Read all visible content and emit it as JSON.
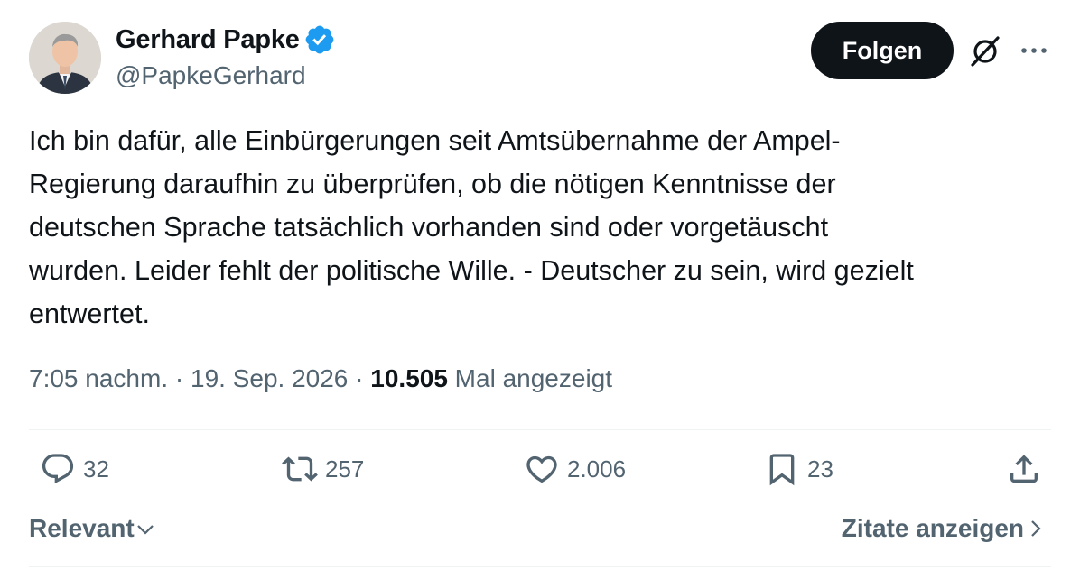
{
  "author": {
    "name": "Gerhard Papke",
    "handle": "@PapkeGerhard",
    "verified": true
  },
  "header": {
    "follow_label": "Folgen",
    "icons": [
      "grok-icon",
      "more-icon"
    ]
  },
  "tweet": {
    "text": "Ich bin dafür, alle Einbürgerungen seit Amtsübernahme der Ampel-\nRegierung daraufhin zu überprüfen, ob die nötigen Kenntnisse der\ndeutschen Sprache tatsächlich vorhanden sind oder vorgetäuscht\nwurden. Leider fehlt der politische Wille. - Deutscher zu sein, wird gezielt\nentwertet.",
    "time": "7:05 nachm.",
    "sep1": " · ",
    "date": "19. Sep. 2026",
    "sep2": " · ",
    "views": "10.505",
    "views_label": " Mal angezeigt"
  },
  "actions": {
    "replies": "32",
    "reposts": "257",
    "likes": "2.006",
    "bookmarks": "23"
  },
  "footer": {
    "sort_label": "Relevant",
    "quotes_label": "Zitate anzeigen"
  },
  "colors": {
    "accent": "#1d9bf0",
    "text": "#0f1419",
    "muted": "#536471",
    "divider": "#eff3f4"
  }
}
